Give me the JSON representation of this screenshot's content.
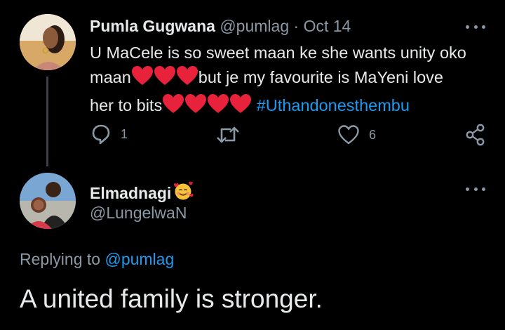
{
  "tweet": {
    "author_name": "Pumla Gugwana",
    "author_handle": "@pumlag",
    "separator": "·",
    "date": "Oct 14",
    "text_line_1": "U MaCele is so sweet maan ke she wants unity oko",
    "text_line_2_a": "maan",
    "text_line_2_b": "but je my favourite is MaYeni love",
    "text_line_3_a": "her to bits",
    "hashtag": "#Uthandonesthembu",
    "reply_count": "1",
    "like_count": "6",
    "icons": [
      "reply-icon",
      "retweet-icon",
      "like-icon",
      "share-icon",
      "more-icon"
    ]
  },
  "reply": {
    "author_name": "Elmadnagi",
    "author_handle": "@LungelwaN",
    "replying_prefix": "Replying to",
    "replying_mention": "@pumlag",
    "text": "A united family is stronger.",
    "icons": [
      "smiling-face-with-hearts-icon",
      "more-icon"
    ]
  },
  "colors": {
    "background": "#000000",
    "primary_text": "#e7e9ea",
    "secondary_text": "#8b98a5",
    "link": "#1d9bf0",
    "heart": "#e8223a",
    "thread_line": "#3d4146"
  }
}
